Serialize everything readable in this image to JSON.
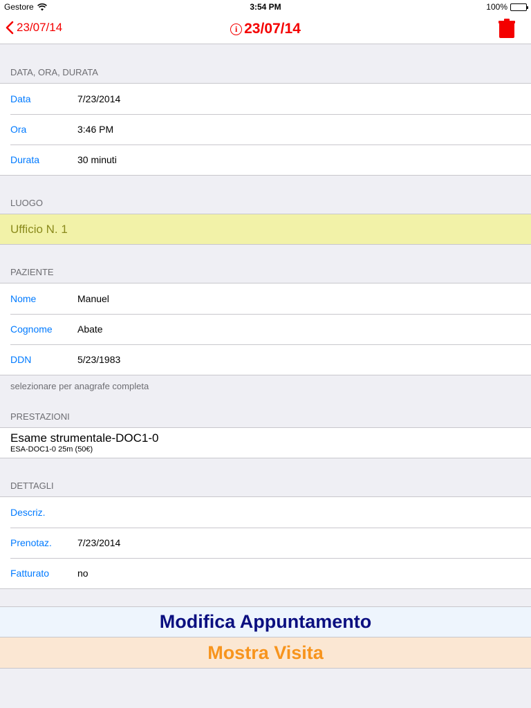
{
  "status": {
    "carrier": "Gestore",
    "time": "3:54 PM",
    "battery": "100%"
  },
  "nav": {
    "back_label": "23/07/14",
    "title": "23/07/14",
    "accent_color": "#f40000"
  },
  "sections": {
    "date_time": {
      "header": "DATA, ORA, DURATA",
      "rows": [
        {
          "label": "Data",
          "value": "7/23/2014"
        },
        {
          "label": "Ora",
          "value": "3:46 PM"
        },
        {
          "label": "Durata",
          "value": "30 minuti"
        }
      ]
    },
    "place": {
      "header": "LUOGO",
      "value": "Ufficio N. 1"
    },
    "patient": {
      "header": "PAZIENTE",
      "rows": [
        {
          "label": "Nome",
          "value": "Manuel"
        },
        {
          "label": "Cognome",
          "value": "Abate"
        },
        {
          "label": "DDN",
          "value": "5/23/1983"
        }
      ],
      "footer": "selezionare per anagrafe completa"
    },
    "services": {
      "header": "PRESTAZIONI",
      "items": [
        {
          "title": "Esame strumentale-DOC1-0",
          "subtitle": "ESA-DOC1-0 25m (50€)"
        }
      ]
    },
    "details": {
      "header": "DETTAGLI",
      "rows": [
        {
          "label": "Descriz.",
          "value": ""
        },
        {
          "label": "Prenotaz.",
          "value": "7/23/2014"
        },
        {
          "label": "Fatturato",
          "value": "no"
        }
      ]
    }
  },
  "buttons": {
    "edit": "Modifica Appuntamento",
    "visit": "Mostra Visita"
  }
}
